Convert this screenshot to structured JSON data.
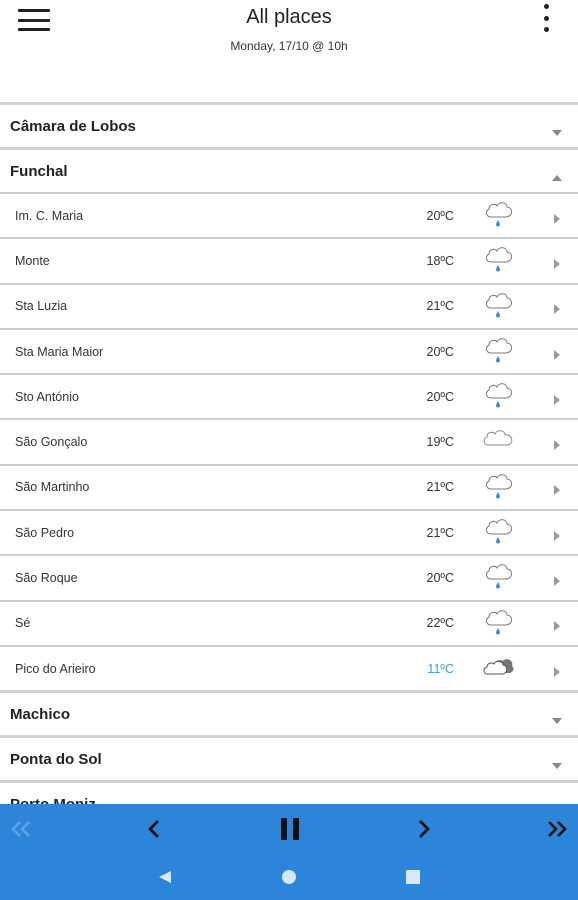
{
  "header": {
    "title": "All places",
    "subtitle": "Monday, 17/10 @ 10h"
  },
  "colors": {
    "accent": "#2c85d8",
    "cold_temp": "#3aa0d8"
  },
  "groups_before": [
    {
      "name": "Câmara de Lobos",
      "expanded": false
    }
  ],
  "expanded_group": {
    "name": "Funchal",
    "expanded": true,
    "places": [
      {
        "name": "Im. C. Maria",
        "temp": "20ºC",
        "icon": "rain-cloud-icon"
      },
      {
        "name": "Monte",
        "temp": "18ºC",
        "icon": "rain-cloud-icon"
      },
      {
        "name": "Sta Luzia",
        "temp": "21ºC",
        "icon": "rain-cloud-icon"
      },
      {
        "name": "Sta Maria Maior",
        "temp": "20ºC",
        "icon": "rain-cloud-icon"
      },
      {
        "name": "Sto António",
        "temp": "20ºC",
        "icon": "rain-cloud-icon"
      },
      {
        "name": "São Gonçalo",
        "temp": "19ºC",
        "icon": "cloud-icon"
      },
      {
        "name": "São Martinho",
        "temp": "21ºC",
        "icon": "rain-cloud-icon"
      },
      {
        "name": "São Pedro",
        "temp": "21ºC",
        "icon": "rain-cloud-icon"
      },
      {
        "name": "São Roque",
        "temp": "20ºC",
        "icon": "rain-cloud-icon"
      },
      {
        "name": "Sé",
        "temp": "22ºC",
        "icon": "rain-cloud-icon"
      },
      {
        "name": "Pico do Arieiro",
        "temp": "11ºC",
        "icon": "dark-cloud-icon",
        "cold": true
      }
    ]
  },
  "groups_after": [
    {
      "name": "Machico",
      "expanded": false
    },
    {
      "name": "Ponta do Sol",
      "expanded": false
    },
    {
      "name": "Porto Moniz",
      "expanded": false
    }
  ],
  "player": {
    "buttons": [
      "skip-back-icon",
      "previous-icon",
      "pause-icon",
      "next-icon",
      "skip-forward-icon"
    ]
  },
  "system_nav": [
    "back-icon",
    "home-icon",
    "recents-icon"
  ]
}
